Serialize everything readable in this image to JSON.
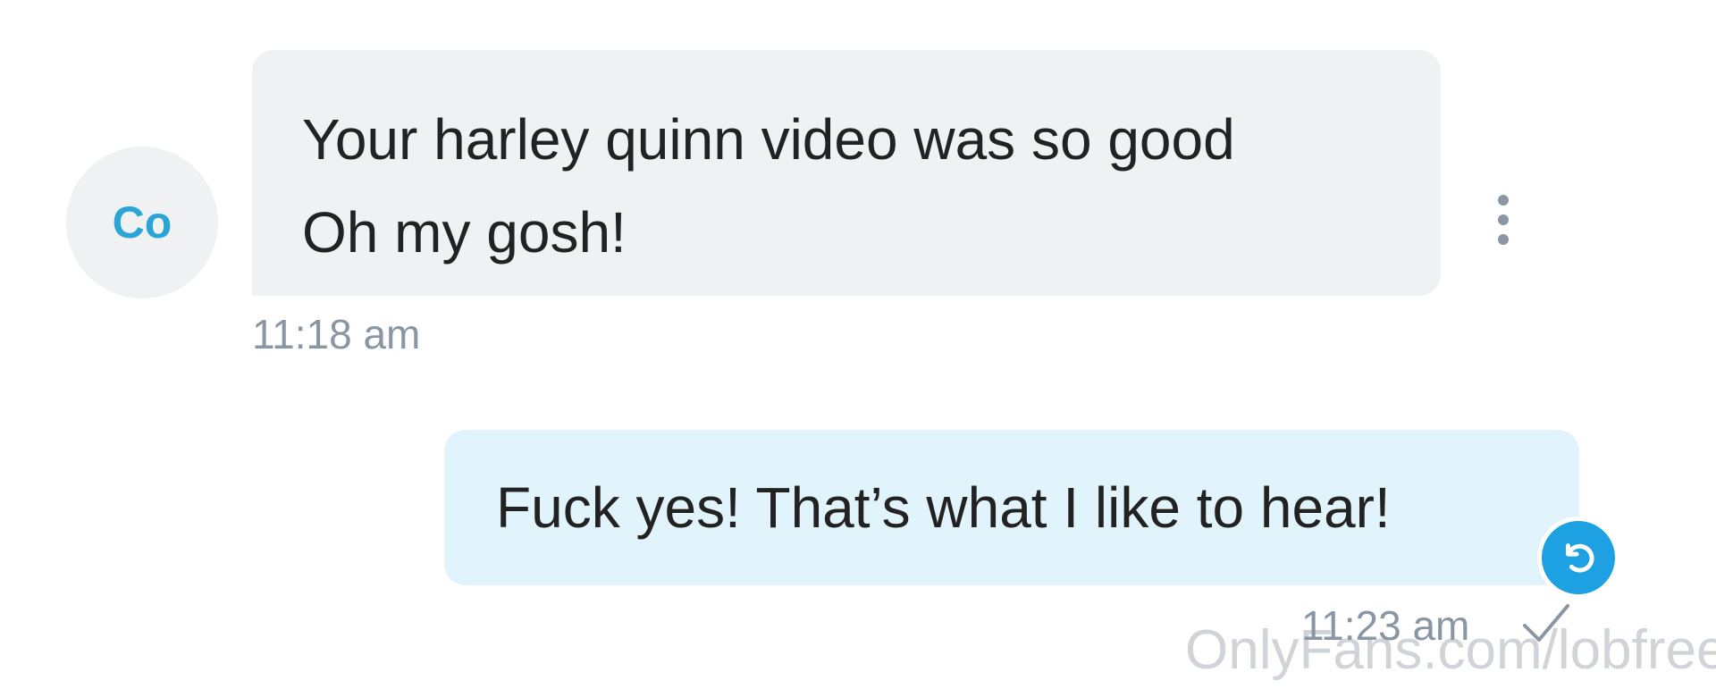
{
  "incoming": {
    "avatar_initials": "Co",
    "lines": [
      "Your harley quinn video was so good",
      "Oh my gosh!"
    ],
    "time": "11:18 am"
  },
  "outgoing": {
    "text": "Fuck yes! That’s what I like to hear!",
    "time": "11:23 am"
  },
  "watermark": "OnlyFans.com/lobfree",
  "icons": {
    "more": "more-vertical-icon",
    "undo": "undo-icon",
    "sent": "check-icon"
  },
  "colors": {
    "accent": "#1da1e2",
    "avatar_text": "#2aa5d6",
    "incoming_bubble": "#f0f1f3",
    "outgoing_bubble": "#e1f4fc",
    "meta_text": "#8a96a3"
  }
}
